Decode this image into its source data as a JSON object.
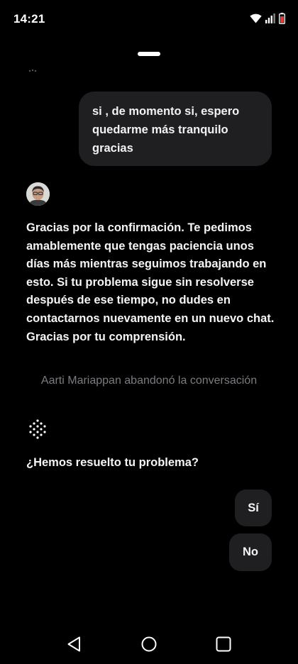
{
  "status_bar": {
    "time": "14:21"
  },
  "conversation": {
    "user_message": "si , de momento si, espero quedarme más tranquilo gracias",
    "agent_message": "Gracias por la confirmación. Te pedimos amablemente que tengas paciencia unos días más mientras seguimos trabajando en esto. Si tu problema sigue sin resolverse después de ese tiempo, no dudes en contactarnos nuevamente en un nuevo chat. Gracias por tu comprensión.",
    "system_note": "Aarti Mariappan abandonó la conversación",
    "bot_question": "¿Hemos resuelto tu problema?"
  },
  "quick_replies": {
    "yes_label": "Sí",
    "no_label": "No"
  },
  "icons": {
    "status": [
      "wifi-icon",
      "signal-icon",
      "battery-icon"
    ],
    "agent": "agent-avatar",
    "bot": "bot-dots-icon",
    "nav": [
      "back-icon",
      "home-icon",
      "recents-icon"
    ]
  },
  "colors": {
    "background": "#000000",
    "bubble": "#1f1f22",
    "system_text": "#7b7b80",
    "battery_accent": "#e53935"
  }
}
